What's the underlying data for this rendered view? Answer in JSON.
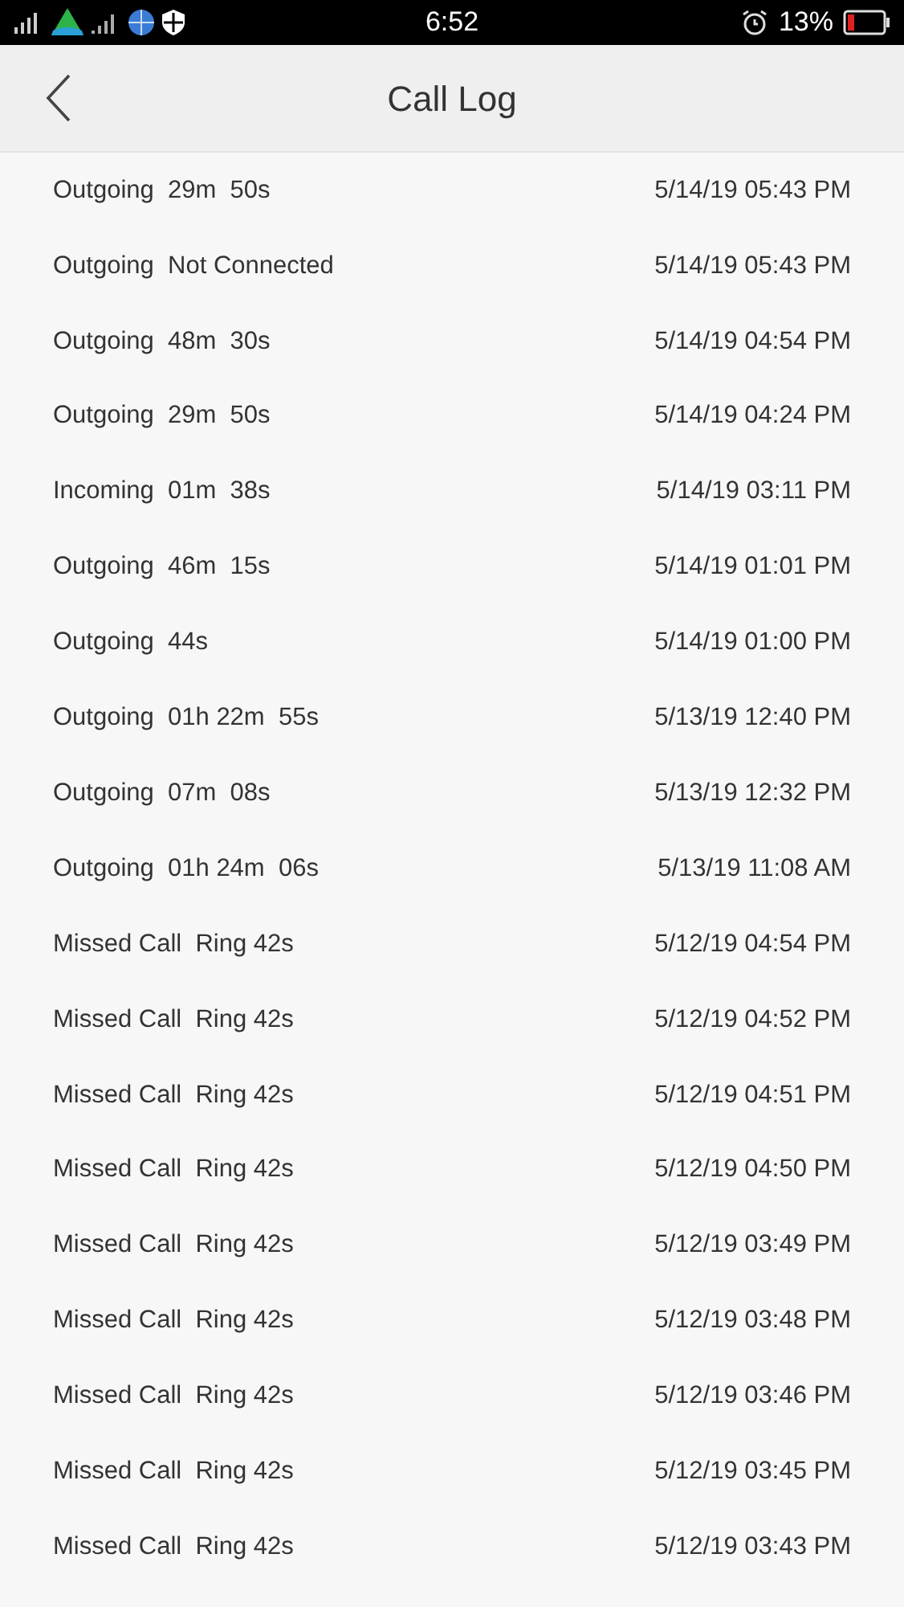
{
  "status_bar": {
    "time": "6:52",
    "battery_percent": "13%"
  },
  "header": {
    "title": "Call Log"
  },
  "calls": [
    {
      "description": "Outgoing  29m  50s",
      "datetime": "5/14/19 05:43 PM"
    },
    {
      "description": "Outgoing  Not Connected",
      "datetime": "5/14/19 05:43 PM"
    },
    {
      "description": "Outgoing  48m  30s",
      "datetime": "5/14/19 04:54 PM"
    },
    {
      "description": "Outgoing  29m  50s",
      "datetime": "5/14/19 04:24 PM"
    },
    {
      "description": "Incoming  01m  38s",
      "datetime": "5/14/19 03:11 PM"
    },
    {
      "description": "Outgoing  46m  15s",
      "datetime": "5/14/19 01:01 PM"
    },
    {
      "description": "Outgoing  44s",
      "datetime": "5/14/19 01:00 PM"
    },
    {
      "description": "Outgoing  01h 22m  55s",
      "datetime": "5/13/19 12:40 PM"
    },
    {
      "description": "Outgoing  07m  08s",
      "datetime": "5/13/19 12:32 PM"
    },
    {
      "description": "Outgoing  01h 24m  06s",
      "datetime": "5/13/19 11:08 AM"
    },
    {
      "description": "Missed Call  Ring 42s",
      "datetime": "5/12/19 04:54 PM"
    },
    {
      "description": "Missed Call  Ring 42s",
      "datetime": "5/12/19 04:52 PM"
    },
    {
      "description": "Missed Call  Ring 42s",
      "datetime": "5/12/19 04:51 PM"
    },
    {
      "description": "Missed Call  Ring 42s",
      "datetime": "5/12/19 04:50 PM"
    },
    {
      "description": "Missed Call  Ring 42s",
      "datetime": "5/12/19 03:49 PM"
    },
    {
      "description": "Missed Call  Ring 42s",
      "datetime": "5/12/19 03:48 PM"
    },
    {
      "description": "Missed Call  Ring 42s",
      "datetime": "5/12/19 03:46 PM"
    },
    {
      "description": "Missed Call  Ring 42s",
      "datetime": "5/12/19 03:45 PM"
    },
    {
      "description": "Missed Call  Ring 42s",
      "datetime": "5/12/19 03:43 PM"
    }
  ]
}
